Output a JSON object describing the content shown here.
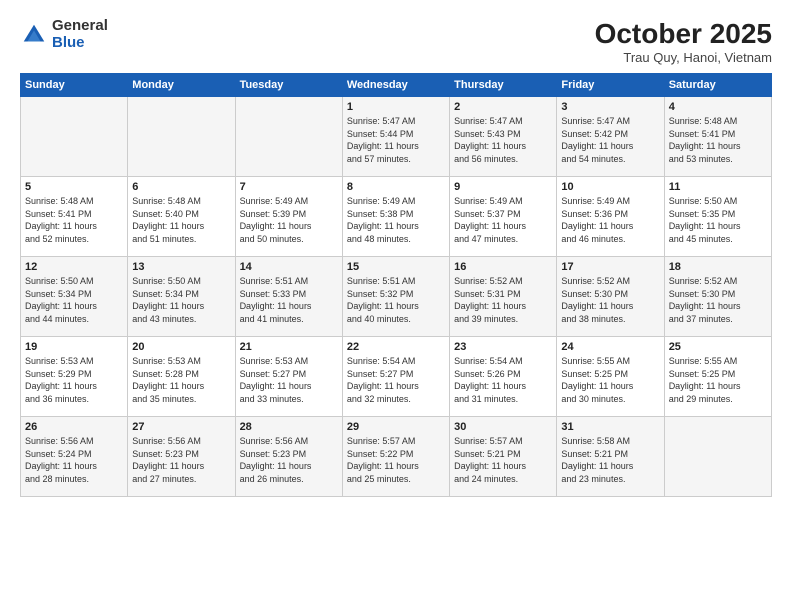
{
  "logo": {
    "general": "General",
    "blue": "Blue"
  },
  "header": {
    "month": "October 2025",
    "location": "Trau Quy, Hanoi, Vietnam"
  },
  "weekdays": [
    "Sunday",
    "Monday",
    "Tuesday",
    "Wednesday",
    "Thursday",
    "Friday",
    "Saturday"
  ],
  "weeks": [
    [
      {
        "day": "",
        "info": ""
      },
      {
        "day": "",
        "info": ""
      },
      {
        "day": "",
        "info": ""
      },
      {
        "day": "1",
        "info": "Sunrise: 5:47 AM\nSunset: 5:44 PM\nDaylight: 11 hours\nand 57 minutes."
      },
      {
        "day": "2",
        "info": "Sunrise: 5:47 AM\nSunset: 5:43 PM\nDaylight: 11 hours\nand 56 minutes."
      },
      {
        "day": "3",
        "info": "Sunrise: 5:47 AM\nSunset: 5:42 PM\nDaylight: 11 hours\nand 54 minutes."
      },
      {
        "day": "4",
        "info": "Sunrise: 5:48 AM\nSunset: 5:41 PM\nDaylight: 11 hours\nand 53 minutes."
      }
    ],
    [
      {
        "day": "5",
        "info": "Sunrise: 5:48 AM\nSunset: 5:41 PM\nDaylight: 11 hours\nand 52 minutes."
      },
      {
        "day": "6",
        "info": "Sunrise: 5:48 AM\nSunset: 5:40 PM\nDaylight: 11 hours\nand 51 minutes."
      },
      {
        "day": "7",
        "info": "Sunrise: 5:49 AM\nSunset: 5:39 PM\nDaylight: 11 hours\nand 50 minutes."
      },
      {
        "day": "8",
        "info": "Sunrise: 5:49 AM\nSunset: 5:38 PM\nDaylight: 11 hours\nand 48 minutes."
      },
      {
        "day": "9",
        "info": "Sunrise: 5:49 AM\nSunset: 5:37 PM\nDaylight: 11 hours\nand 47 minutes."
      },
      {
        "day": "10",
        "info": "Sunrise: 5:49 AM\nSunset: 5:36 PM\nDaylight: 11 hours\nand 46 minutes."
      },
      {
        "day": "11",
        "info": "Sunrise: 5:50 AM\nSunset: 5:35 PM\nDaylight: 11 hours\nand 45 minutes."
      }
    ],
    [
      {
        "day": "12",
        "info": "Sunrise: 5:50 AM\nSunset: 5:34 PM\nDaylight: 11 hours\nand 44 minutes."
      },
      {
        "day": "13",
        "info": "Sunrise: 5:50 AM\nSunset: 5:34 PM\nDaylight: 11 hours\nand 43 minutes."
      },
      {
        "day": "14",
        "info": "Sunrise: 5:51 AM\nSunset: 5:33 PM\nDaylight: 11 hours\nand 41 minutes."
      },
      {
        "day": "15",
        "info": "Sunrise: 5:51 AM\nSunset: 5:32 PM\nDaylight: 11 hours\nand 40 minutes."
      },
      {
        "day": "16",
        "info": "Sunrise: 5:52 AM\nSunset: 5:31 PM\nDaylight: 11 hours\nand 39 minutes."
      },
      {
        "day": "17",
        "info": "Sunrise: 5:52 AM\nSunset: 5:30 PM\nDaylight: 11 hours\nand 38 minutes."
      },
      {
        "day": "18",
        "info": "Sunrise: 5:52 AM\nSunset: 5:30 PM\nDaylight: 11 hours\nand 37 minutes."
      }
    ],
    [
      {
        "day": "19",
        "info": "Sunrise: 5:53 AM\nSunset: 5:29 PM\nDaylight: 11 hours\nand 36 minutes."
      },
      {
        "day": "20",
        "info": "Sunrise: 5:53 AM\nSunset: 5:28 PM\nDaylight: 11 hours\nand 35 minutes."
      },
      {
        "day": "21",
        "info": "Sunrise: 5:53 AM\nSunset: 5:27 PM\nDaylight: 11 hours\nand 33 minutes."
      },
      {
        "day": "22",
        "info": "Sunrise: 5:54 AM\nSunset: 5:27 PM\nDaylight: 11 hours\nand 32 minutes."
      },
      {
        "day": "23",
        "info": "Sunrise: 5:54 AM\nSunset: 5:26 PM\nDaylight: 11 hours\nand 31 minutes."
      },
      {
        "day": "24",
        "info": "Sunrise: 5:55 AM\nSunset: 5:25 PM\nDaylight: 11 hours\nand 30 minutes."
      },
      {
        "day": "25",
        "info": "Sunrise: 5:55 AM\nSunset: 5:25 PM\nDaylight: 11 hours\nand 29 minutes."
      }
    ],
    [
      {
        "day": "26",
        "info": "Sunrise: 5:56 AM\nSunset: 5:24 PM\nDaylight: 11 hours\nand 28 minutes."
      },
      {
        "day": "27",
        "info": "Sunrise: 5:56 AM\nSunset: 5:23 PM\nDaylight: 11 hours\nand 27 minutes."
      },
      {
        "day": "28",
        "info": "Sunrise: 5:56 AM\nSunset: 5:23 PM\nDaylight: 11 hours\nand 26 minutes."
      },
      {
        "day": "29",
        "info": "Sunrise: 5:57 AM\nSunset: 5:22 PM\nDaylight: 11 hours\nand 25 minutes."
      },
      {
        "day": "30",
        "info": "Sunrise: 5:57 AM\nSunset: 5:21 PM\nDaylight: 11 hours\nand 24 minutes."
      },
      {
        "day": "31",
        "info": "Sunrise: 5:58 AM\nSunset: 5:21 PM\nDaylight: 11 hours\nand 23 minutes."
      },
      {
        "day": "",
        "info": ""
      }
    ]
  ]
}
